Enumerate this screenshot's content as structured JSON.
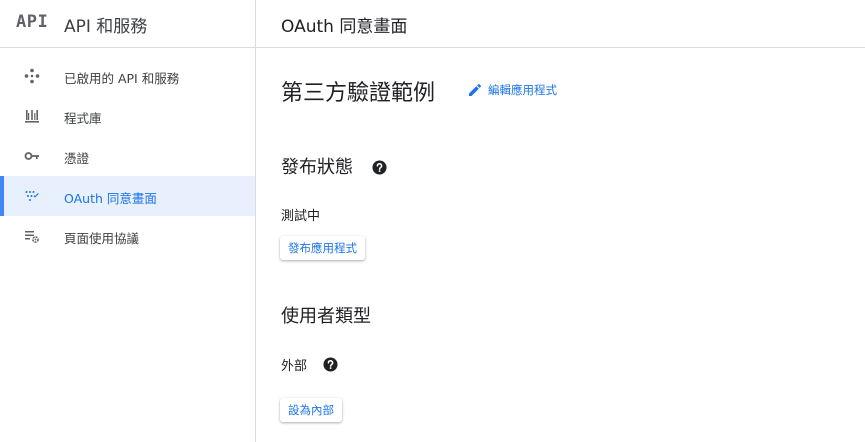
{
  "sidebar": {
    "logo": "API",
    "title": "API 和服務",
    "items": [
      {
        "label": "已啟用的 API 和服務",
        "icon": "diamond-grid-icon"
      },
      {
        "label": "程式庫",
        "icon": "library-icon"
      },
      {
        "label": "憑證",
        "icon": "key-icon"
      },
      {
        "label": "OAuth 同意畫面",
        "icon": "oauth-dots-icon"
      },
      {
        "label": "頁面使用協議",
        "icon": "settings-list-icon"
      }
    ],
    "active_index": 3
  },
  "header": {
    "title": "OAuth 同意畫面"
  },
  "main": {
    "app_name": "第三方驗證範例",
    "edit_label": "編輯應用程式",
    "publishing_status": {
      "title": "發布狀態",
      "value": "測試中",
      "button": "發布應用程式"
    },
    "user_type": {
      "title": "使用者類型",
      "value": "外部",
      "button": "設為內部"
    }
  },
  "colors": {
    "accent": "#1a73e8",
    "active_bg": "#e8f0fe",
    "active_bar": "#4285f4",
    "icon_gray": "#5f6368",
    "divider": "#dadce0"
  }
}
